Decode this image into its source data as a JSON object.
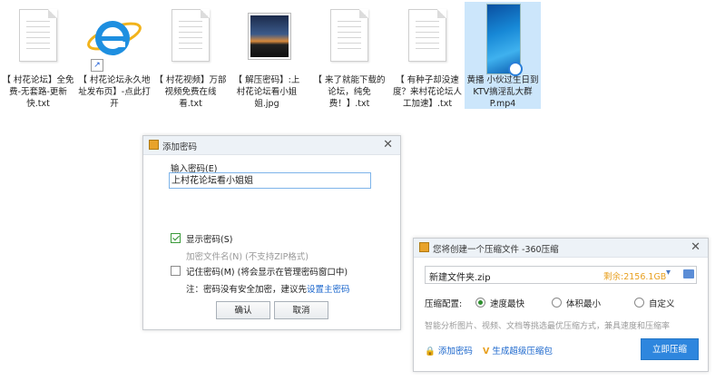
{
  "files": [
    {
      "name": "【 村花论坛】全免费-无套路-更新快.txt",
      "icon": "text-file-icon"
    },
    {
      "name": "【 村花论坛永久地址发布页】-点此打开",
      "icon": "internet-explorer-shortcut-icon"
    },
    {
      "name": "【 村花视频】万部视频免费在线看.txt",
      "icon": "text-file-icon"
    },
    {
      "name": "【 解压密码】:上村花论坛看小姐姐.jpg",
      "icon": "image-file-icon"
    },
    {
      "name": "【 来了就能下载的论坛，纯免费！】.txt",
      "icon": "text-file-icon"
    },
    {
      "name": "【 有种子却没速度？来村花论坛人工加速】.txt",
      "icon": "text-file-icon"
    },
    {
      "name": "黄播 小伙过生日到KTV搞淫乱大群P.mp4",
      "icon": "video-file-icon"
    }
  ],
  "password_dialog": {
    "title": "添加密码",
    "input_label": "输入密码(E)",
    "input_value": "上村花论坛看小姐姐",
    "show_password": {
      "label": "显示密码(S)",
      "checked": true
    },
    "encrypt_filenames": {
      "label": "加密文件名(N)",
      "note": "(不支持ZIP格式)",
      "enabled": false
    },
    "remember_password": {
      "label": "记住密码(M)",
      "note": "(将会显示在管理密码窗口中)",
      "checked": false
    },
    "note_prefix": "注：密码没有安全加密，建议先",
    "note_link": "设置主密码",
    "ok_label": "确认",
    "cancel_label": "取消"
  },
  "compress_dialog": {
    "title": "您将创建一个压缩文件 -360压缩",
    "filename": "新建文件夹.zip",
    "free_space": "剩余:2156.1GB",
    "config_label": "压缩配置:",
    "options": [
      {
        "label": "速度最快",
        "selected": true
      },
      {
        "label": "体积最小",
        "selected": false
      },
      {
        "label": "自定义",
        "selected": false
      }
    ],
    "hint": "智能分析图片、视频、文档等挑选最优压缩方式，兼具速度和压缩率",
    "add_password": "添加密码",
    "super_package": "生成超级压缩包",
    "compress_now": "立即压缩"
  },
  "colors": {
    "accent": "#2e86de",
    "link": "#1a66cc",
    "free_space": "#e8a020"
  }
}
